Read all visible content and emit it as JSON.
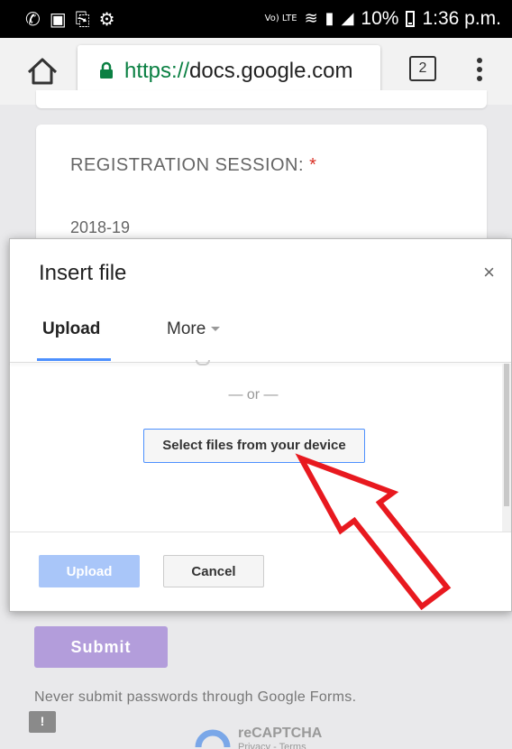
{
  "status_bar": {
    "left_icons": [
      "whatsapp-icon",
      "image-icon",
      "cast-icon",
      "settings-icon"
    ],
    "volte": "Vo) LTE",
    "battery": "10%",
    "time": "1:36 p.m."
  },
  "browser": {
    "url_scheme": "https://",
    "url_host": "docs.google.com",
    "tab_count": "2",
    "secure_color": "#0b8043"
  },
  "form": {
    "question_title": "REGISTRATION SESSION:",
    "required_mark": "*",
    "answer": "2018-19",
    "submit_label": "Submit",
    "notice": "Never submit passwords through Google Forms.",
    "recaptcha_title": "reCAPTCHA",
    "recaptcha_links": "Privacy - Terms"
  },
  "dialog": {
    "title": "Insert file",
    "close_glyph": "×",
    "tabs": [
      {
        "label": "Upload",
        "active": true
      },
      {
        "label": "More",
        "active": false
      }
    ],
    "or_text": "— or —",
    "select_files_label": "Select files from your device",
    "upload_label": "Upload",
    "cancel_label": "Cancel",
    "accent_color": "#4d90fe"
  },
  "annotation": {
    "arrow_color": "#e8191f"
  }
}
